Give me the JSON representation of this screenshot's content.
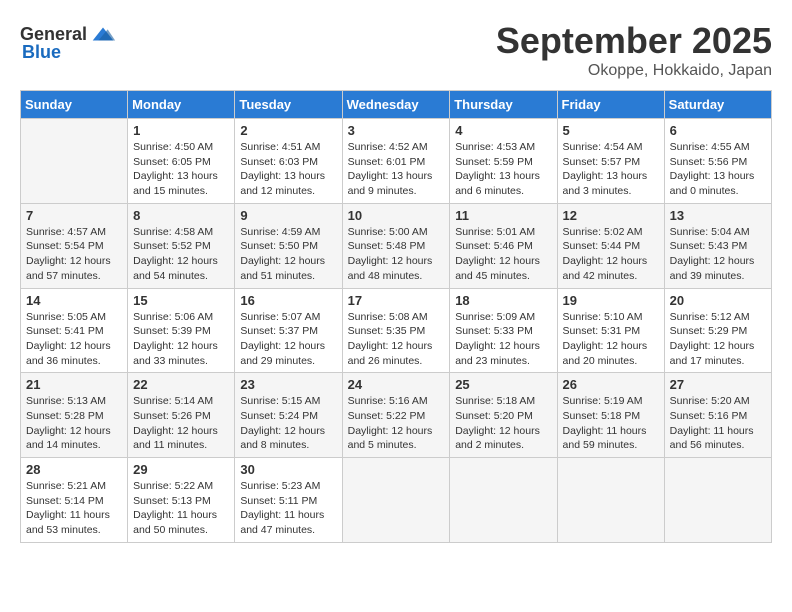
{
  "header": {
    "logo_general": "General",
    "logo_blue": "Blue",
    "month_year": "September 2025",
    "location": "Okoppe, Hokkaido, Japan"
  },
  "columns": [
    "Sunday",
    "Monday",
    "Tuesday",
    "Wednesday",
    "Thursday",
    "Friday",
    "Saturday"
  ],
  "weeks": [
    [
      {
        "day": "",
        "sunrise": "",
        "sunset": "",
        "daylight": ""
      },
      {
        "day": "1",
        "sunrise": "Sunrise: 4:50 AM",
        "sunset": "Sunset: 6:05 PM",
        "daylight": "Daylight: 13 hours and 15 minutes."
      },
      {
        "day": "2",
        "sunrise": "Sunrise: 4:51 AM",
        "sunset": "Sunset: 6:03 PM",
        "daylight": "Daylight: 13 hours and 12 minutes."
      },
      {
        "day": "3",
        "sunrise": "Sunrise: 4:52 AM",
        "sunset": "Sunset: 6:01 PM",
        "daylight": "Daylight: 13 hours and 9 minutes."
      },
      {
        "day": "4",
        "sunrise": "Sunrise: 4:53 AM",
        "sunset": "Sunset: 5:59 PM",
        "daylight": "Daylight: 13 hours and 6 minutes."
      },
      {
        "day": "5",
        "sunrise": "Sunrise: 4:54 AM",
        "sunset": "Sunset: 5:57 PM",
        "daylight": "Daylight: 13 hours and 3 minutes."
      },
      {
        "day": "6",
        "sunrise": "Sunrise: 4:55 AM",
        "sunset": "Sunset: 5:56 PM",
        "daylight": "Daylight: 13 hours and 0 minutes."
      }
    ],
    [
      {
        "day": "7",
        "sunrise": "Sunrise: 4:57 AM",
        "sunset": "Sunset: 5:54 PM",
        "daylight": "Daylight: 12 hours and 57 minutes."
      },
      {
        "day": "8",
        "sunrise": "Sunrise: 4:58 AM",
        "sunset": "Sunset: 5:52 PM",
        "daylight": "Daylight: 12 hours and 54 minutes."
      },
      {
        "day": "9",
        "sunrise": "Sunrise: 4:59 AM",
        "sunset": "Sunset: 5:50 PM",
        "daylight": "Daylight: 12 hours and 51 minutes."
      },
      {
        "day": "10",
        "sunrise": "Sunrise: 5:00 AM",
        "sunset": "Sunset: 5:48 PM",
        "daylight": "Daylight: 12 hours and 48 minutes."
      },
      {
        "day": "11",
        "sunrise": "Sunrise: 5:01 AM",
        "sunset": "Sunset: 5:46 PM",
        "daylight": "Daylight: 12 hours and 45 minutes."
      },
      {
        "day": "12",
        "sunrise": "Sunrise: 5:02 AM",
        "sunset": "Sunset: 5:44 PM",
        "daylight": "Daylight: 12 hours and 42 minutes."
      },
      {
        "day": "13",
        "sunrise": "Sunrise: 5:04 AM",
        "sunset": "Sunset: 5:43 PM",
        "daylight": "Daylight: 12 hours and 39 minutes."
      }
    ],
    [
      {
        "day": "14",
        "sunrise": "Sunrise: 5:05 AM",
        "sunset": "Sunset: 5:41 PM",
        "daylight": "Daylight: 12 hours and 36 minutes."
      },
      {
        "day": "15",
        "sunrise": "Sunrise: 5:06 AM",
        "sunset": "Sunset: 5:39 PM",
        "daylight": "Daylight: 12 hours and 33 minutes."
      },
      {
        "day": "16",
        "sunrise": "Sunrise: 5:07 AM",
        "sunset": "Sunset: 5:37 PM",
        "daylight": "Daylight: 12 hours and 29 minutes."
      },
      {
        "day": "17",
        "sunrise": "Sunrise: 5:08 AM",
        "sunset": "Sunset: 5:35 PM",
        "daylight": "Daylight: 12 hours and 26 minutes."
      },
      {
        "day": "18",
        "sunrise": "Sunrise: 5:09 AM",
        "sunset": "Sunset: 5:33 PM",
        "daylight": "Daylight: 12 hours and 23 minutes."
      },
      {
        "day": "19",
        "sunrise": "Sunrise: 5:10 AM",
        "sunset": "Sunset: 5:31 PM",
        "daylight": "Daylight: 12 hours and 20 minutes."
      },
      {
        "day": "20",
        "sunrise": "Sunrise: 5:12 AM",
        "sunset": "Sunset: 5:29 PM",
        "daylight": "Daylight: 12 hours and 17 minutes."
      }
    ],
    [
      {
        "day": "21",
        "sunrise": "Sunrise: 5:13 AM",
        "sunset": "Sunset: 5:28 PM",
        "daylight": "Daylight: 12 hours and 14 minutes."
      },
      {
        "day": "22",
        "sunrise": "Sunrise: 5:14 AM",
        "sunset": "Sunset: 5:26 PM",
        "daylight": "Daylight: 12 hours and 11 minutes."
      },
      {
        "day": "23",
        "sunrise": "Sunrise: 5:15 AM",
        "sunset": "Sunset: 5:24 PM",
        "daylight": "Daylight: 12 hours and 8 minutes."
      },
      {
        "day": "24",
        "sunrise": "Sunrise: 5:16 AM",
        "sunset": "Sunset: 5:22 PM",
        "daylight": "Daylight: 12 hours and 5 minutes."
      },
      {
        "day": "25",
        "sunrise": "Sunrise: 5:18 AM",
        "sunset": "Sunset: 5:20 PM",
        "daylight": "Daylight: 12 hours and 2 minutes."
      },
      {
        "day": "26",
        "sunrise": "Sunrise: 5:19 AM",
        "sunset": "Sunset: 5:18 PM",
        "daylight": "Daylight: 11 hours and 59 minutes."
      },
      {
        "day": "27",
        "sunrise": "Sunrise: 5:20 AM",
        "sunset": "Sunset: 5:16 PM",
        "daylight": "Daylight: 11 hours and 56 minutes."
      }
    ],
    [
      {
        "day": "28",
        "sunrise": "Sunrise: 5:21 AM",
        "sunset": "Sunset: 5:14 PM",
        "daylight": "Daylight: 11 hours and 53 minutes."
      },
      {
        "day": "29",
        "sunrise": "Sunrise: 5:22 AM",
        "sunset": "Sunset: 5:13 PM",
        "daylight": "Daylight: 11 hours and 50 minutes."
      },
      {
        "day": "30",
        "sunrise": "Sunrise: 5:23 AM",
        "sunset": "Sunset: 5:11 PM",
        "daylight": "Daylight: 11 hours and 47 minutes."
      },
      {
        "day": "",
        "sunrise": "",
        "sunset": "",
        "daylight": ""
      },
      {
        "day": "",
        "sunrise": "",
        "sunset": "",
        "daylight": ""
      },
      {
        "day": "",
        "sunrise": "",
        "sunset": "",
        "daylight": ""
      },
      {
        "day": "",
        "sunrise": "",
        "sunset": "",
        "daylight": ""
      }
    ]
  ]
}
